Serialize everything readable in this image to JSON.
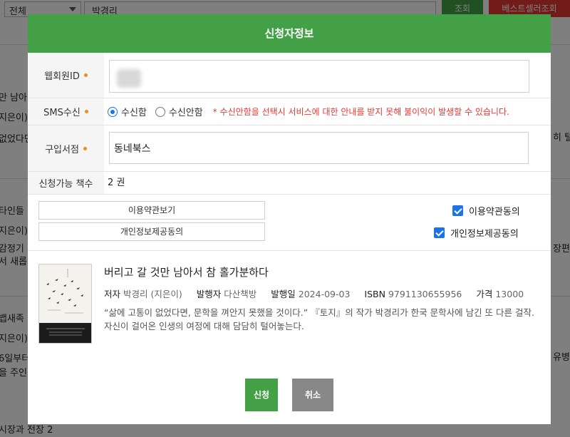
{
  "background": {
    "category_select": "전체",
    "search_value": "박경리",
    "search_button": "조회",
    "bestseller_button": "베스트셀러조회",
    "snippets": [
      "만 남아",
      "지은이)",
      "없었다면",
      "타인들",
      "지은이)",
      "감정기",
      "서 새롭",
      "뱁새족",
      "지은이)",
      "6일부터",
      "을 주인",
      "시장과 전장 2",
      "히 털어",
      "장편",
      "유병"
    ]
  },
  "modal": {
    "title": "신청자정보",
    "fields": {
      "web_id_label": "웹회원ID",
      "web_id_value": "",
      "sms_label": "SMS수신",
      "sms_options": [
        "수신함",
        "수신안함"
      ],
      "sms_selected": "수신함",
      "sms_notice": "* 수신안함을 선택시 서비스에 대한 안내를 받지 못해 불이익이 발생할 수 있습니다.",
      "store_label": "구입서점",
      "store_value": "동네북스",
      "available_label": "신청가능 책수",
      "available_value": "2 권"
    },
    "agreements": {
      "terms_view_button": "이용약관보기",
      "privacy_view_button": "개인정보제공동의",
      "terms_agree_label": "이용약관동의",
      "terms_agree_checked": true,
      "privacy_agree_label": "개인정보제공동의",
      "privacy_agree_checked": true
    },
    "book": {
      "title": "버리고 갈 것만 남아서 참 홀가분하다",
      "author_key": "저자",
      "author": "박경리 (지은이)",
      "publisher_key": "발행자",
      "publisher": "다산책방",
      "date_key": "발행일",
      "date": "2024-09-03",
      "isbn_key": "ISBN",
      "isbn": "9791130655956",
      "price_key": "가격",
      "price": "13000",
      "description": "“삶에 고통이 없었다면, 문학을 껴안지 못했을 것이다.” 『토지』의 작가 박경리가 한국 문학사에 남긴 또 다른 걸작. 자신이 걸어온 인생의 여정에 대해 담담히 털어놓는다.",
      "cover_icon": "book-cover-image"
    },
    "buttons": {
      "apply": "신청",
      "cancel": "취소"
    }
  },
  "colors": {
    "accent_green": "#43a047",
    "danger_red": "#e53935",
    "required_dot": "#f08c1e",
    "checkbox_blue": "#1a73e8"
  }
}
